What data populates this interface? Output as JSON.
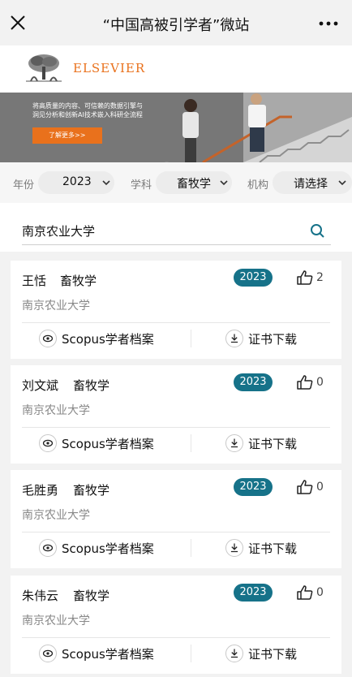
{
  "header": {
    "title": "“中国高被引学者”微站",
    "close_icon": "close-icon",
    "more_icon": "more-icon"
  },
  "publisher": {
    "brand": "ELSEVIER",
    "logo_icon": "elsevier-tree-icon",
    "brand_color": "#e9711c"
  },
  "banner": {
    "line1": "将高质量的内容、可信赖的数据引擎与",
    "line2": "洞见分析和创新AI技术嵌入科研全流程",
    "cta": "了解更多>>",
    "slides": 2,
    "active_slide": 1
  },
  "filters": {
    "year_label": "年份",
    "year_value": "2023",
    "subject_label": "学科",
    "subject_value": "畜牧学",
    "org_label": "机构",
    "org_value": "请选择"
  },
  "search": {
    "value": "南京农业大学",
    "placeholder": ""
  },
  "colors": {
    "accent": "#167289",
    "orange": "#e9711c"
  },
  "scholars": [
    {
      "name": "王恬",
      "subject": "畜牧学",
      "year": "2023",
      "likes": "2",
      "org": "南京农业大学",
      "profile_label": "Scopus学者档案",
      "download_label": "证书下载"
    },
    {
      "name": "刘文斌",
      "subject": "畜牧学",
      "year": "2023",
      "likes": "0",
      "org": "南京农业大学",
      "profile_label": "Scopus学者档案",
      "download_label": "证书下载"
    },
    {
      "name": "毛胜勇",
      "subject": "畜牧学",
      "year": "2023",
      "likes": "0",
      "org": "南京农业大学",
      "profile_label": "Scopus学者档案",
      "download_label": "证书下载"
    },
    {
      "name": "朱伟云",
      "subject": "畜牧学",
      "year": "2023",
      "likes": "0",
      "org": "南京农业大学",
      "profile_label": "Scopus学者档案",
      "download_label": "证书下载"
    }
  ]
}
